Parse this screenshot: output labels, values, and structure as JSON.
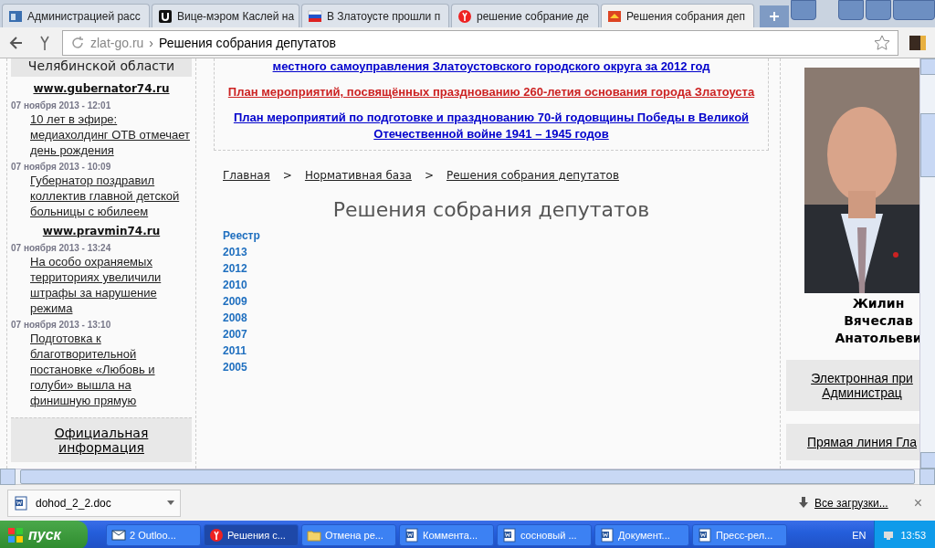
{
  "tabs": [
    {
      "title": "Администрацией расс",
      "kind": "doc",
      "selected": false
    },
    {
      "title": "Вице-мэром Каслей на",
      "kind": "u",
      "selected": false
    },
    {
      "title": "В Златоусте прошли п",
      "kind": "flag",
      "selected": false
    },
    {
      "title": "решение собрание де",
      "kind": "ya",
      "selected": false
    },
    {
      "title": "Решения собрания деп",
      "kind": "crest",
      "selected": true
    }
  ],
  "address_bar": {
    "domain": "zlat-go.ru",
    "separator": "›",
    "page_title": "Решения собрания депутатов"
  },
  "left_sidebar": {
    "heading": "Челябинской области",
    "groups": [
      {
        "site": "www.gubernator74.ru",
        "news": [
          {
            "date": "07 ноября 2013 - 12:01",
            "title": "10 лет в эфире: медиахолдинг ОТВ отмечает день рождения"
          },
          {
            "date": "07 ноября 2013 - 10:09",
            "title": "Губернатор поздравил коллектив главной детской больницы с юбилеем"
          }
        ]
      },
      {
        "site": "www.pravmin74.ru",
        "news": [
          {
            "date": "07 ноября 2013 - 13:24",
            "title": "На особо охраняемых территориях увеличили штрафы за нарушение режима"
          },
          {
            "date": "07 ноября 2013 - 13:10",
            "title": "Подготовка к благотворительной постановке «Любовь и голуби» вышла на финишную прямую"
          }
        ]
      }
    ],
    "official_box": "Официальная информация"
  },
  "main": {
    "featured_links": [
      {
        "text": "местного самоуправления Златоустовского городского округа за 2012 год",
        "color": "#0000cc"
      },
      {
        "text": "План мероприятий, посвящённых празднованию 260-летия основания города Златоуста",
        "color": "#cc2222"
      },
      {
        "text": "План мероприятий по подготовке и празднованию 70-й годовщины Победы в Великой Отечественной войне 1941 – 1945 годов",
        "color": "#0000cc"
      }
    ],
    "breadcrumb": [
      {
        "text": "Главная"
      },
      {
        "text": ">"
      },
      {
        "text": "Нормативная база"
      },
      {
        "text": ">"
      },
      {
        "text": "Решения собрания депутатов"
      }
    ],
    "title": "Решения собрания депутатов",
    "links": [
      "Реестр",
      "2013",
      "2012",
      "2010",
      "2009",
      "2008",
      "2007",
      "2011",
      "2005"
    ]
  },
  "right_sidebar": {
    "photo": {
      "kind": "picture"
    },
    "name": [
      "Жилин",
      "Вячеслав",
      "Анатольеви"
    ],
    "boxes": [
      [
        "Электронная при",
        "Администрац"
      ],
      [
        "Прямая линия Гла"
      ]
    ]
  },
  "download_bar": {
    "file": "dohod_2_2.doc",
    "all_downloads": "Все загрузки...",
    "close": "×"
  },
  "taskbar": {
    "start": "пуск",
    "items": [
      {
        "label": "2 Outloo...",
        "kind": "outlook",
        "selected": false
      },
      {
        "label": "Решения с...",
        "kind": "ya",
        "selected": true
      },
      {
        "label": "Отмена ре...",
        "kind": "folder",
        "selected": false
      },
      {
        "label": "Коммента...",
        "kind": "word",
        "selected": false
      },
      {
        "label": "сосновый ...",
        "kind": "word",
        "selected": false
      },
      {
        "label": "Документ...",
        "kind": "word",
        "selected": false
      },
      {
        "label": "Пресс-рел...",
        "kind": "word",
        "selected": false
      }
    ],
    "language": "EN",
    "time": "13:53"
  }
}
